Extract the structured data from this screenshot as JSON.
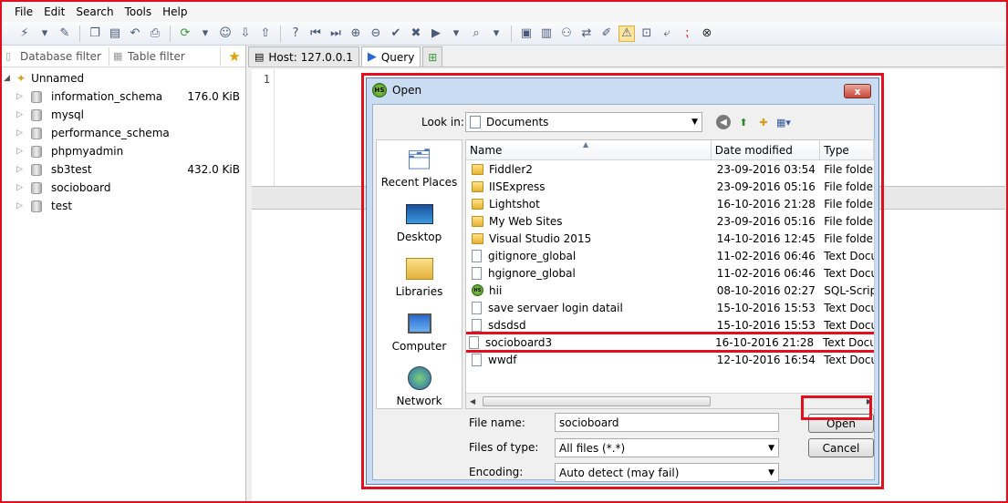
{
  "menu": [
    "File",
    "Edit",
    "Search",
    "Tools",
    "Help"
  ],
  "left": {
    "database_filter": "Database filter",
    "table_filter": "Table filter",
    "root": "Unnamed",
    "databases": [
      {
        "name": "information_schema",
        "size": "176.0 KiB"
      },
      {
        "name": "mysql",
        "size": ""
      },
      {
        "name": "performance_schema",
        "size": ""
      },
      {
        "name": "phpmyadmin",
        "size": ""
      },
      {
        "name": "sb3test",
        "size": "432.0 KiB"
      },
      {
        "name": "socioboard",
        "size": ""
      },
      {
        "name": "test",
        "size": ""
      }
    ]
  },
  "tabs": {
    "host": "Host: 127.0.0.1",
    "query": "Query"
  },
  "editor": {
    "line": "1"
  },
  "dialog": {
    "title": "Open",
    "icon_text": "HS",
    "lookin_label": "Look in:",
    "lookin_value": "Documents",
    "places": [
      "Recent Places",
      "Desktop",
      "Libraries",
      "Computer",
      "Network"
    ],
    "columns": {
      "name": "Name",
      "date": "Date modified",
      "type": "Type"
    },
    "files": [
      {
        "name": "Fiddler2",
        "date": "23-09-2016 03:54",
        "type": "File folder",
        "kind": "folder"
      },
      {
        "name": "IISExpress",
        "date": "23-09-2016 05:16",
        "type": "File folder",
        "kind": "folder"
      },
      {
        "name": "Lightshot",
        "date": "16-10-2016 21:28",
        "type": "File folder",
        "kind": "folder"
      },
      {
        "name": "My Web Sites",
        "date": "23-09-2016 05:16",
        "type": "File folder",
        "kind": "folder"
      },
      {
        "name": "Visual Studio 2015",
        "date": "14-10-2016 12:45",
        "type": "File folder",
        "kind": "folder"
      },
      {
        "name": "gitignore_global",
        "date": "11-02-2016 06:46",
        "type": "Text Docu",
        "kind": "text"
      },
      {
        "name": "hgignore_global",
        "date": "11-02-2016 06:46",
        "type": "Text Docu",
        "kind": "text"
      },
      {
        "name": "hii",
        "date": "08-10-2016 02:27",
        "type": "SQL-Scrip",
        "kind": "sql"
      },
      {
        "name": "save servaer login datail",
        "date": "15-10-2016 15:53",
        "type": "Text Docu",
        "kind": "text"
      },
      {
        "name": "sdsdsd",
        "date": "15-10-2016 15:53",
        "type": "Text Docu",
        "kind": "text"
      },
      {
        "name": "socioboard3",
        "date": "16-10-2016 21:28",
        "type": "Text Docu",
        "kind": "text"
      },
      {
        "name": "wwdf",
        "date": "12-10-2016 16:54",
        "type": "Text Docu",
        "kind": "text"
      }
    ],
    "filename_label": "File name:",
    "filename_value": "socioboard",
    "filetype_label": "Files of type:",
    "filetype_value": "All files (*.*)",
    "encoding_label": "Encoding:",
    "encoding_value": "Auto detect (may fail)",
    "open_button": "Open",
    "cancel_button": "Cancel",
    "close_glyph": "x"
  },
  "colors": {
    "highlight_red": "#e0101e",
    "dialog_chrome": "#c9dcf2"
  }
}
